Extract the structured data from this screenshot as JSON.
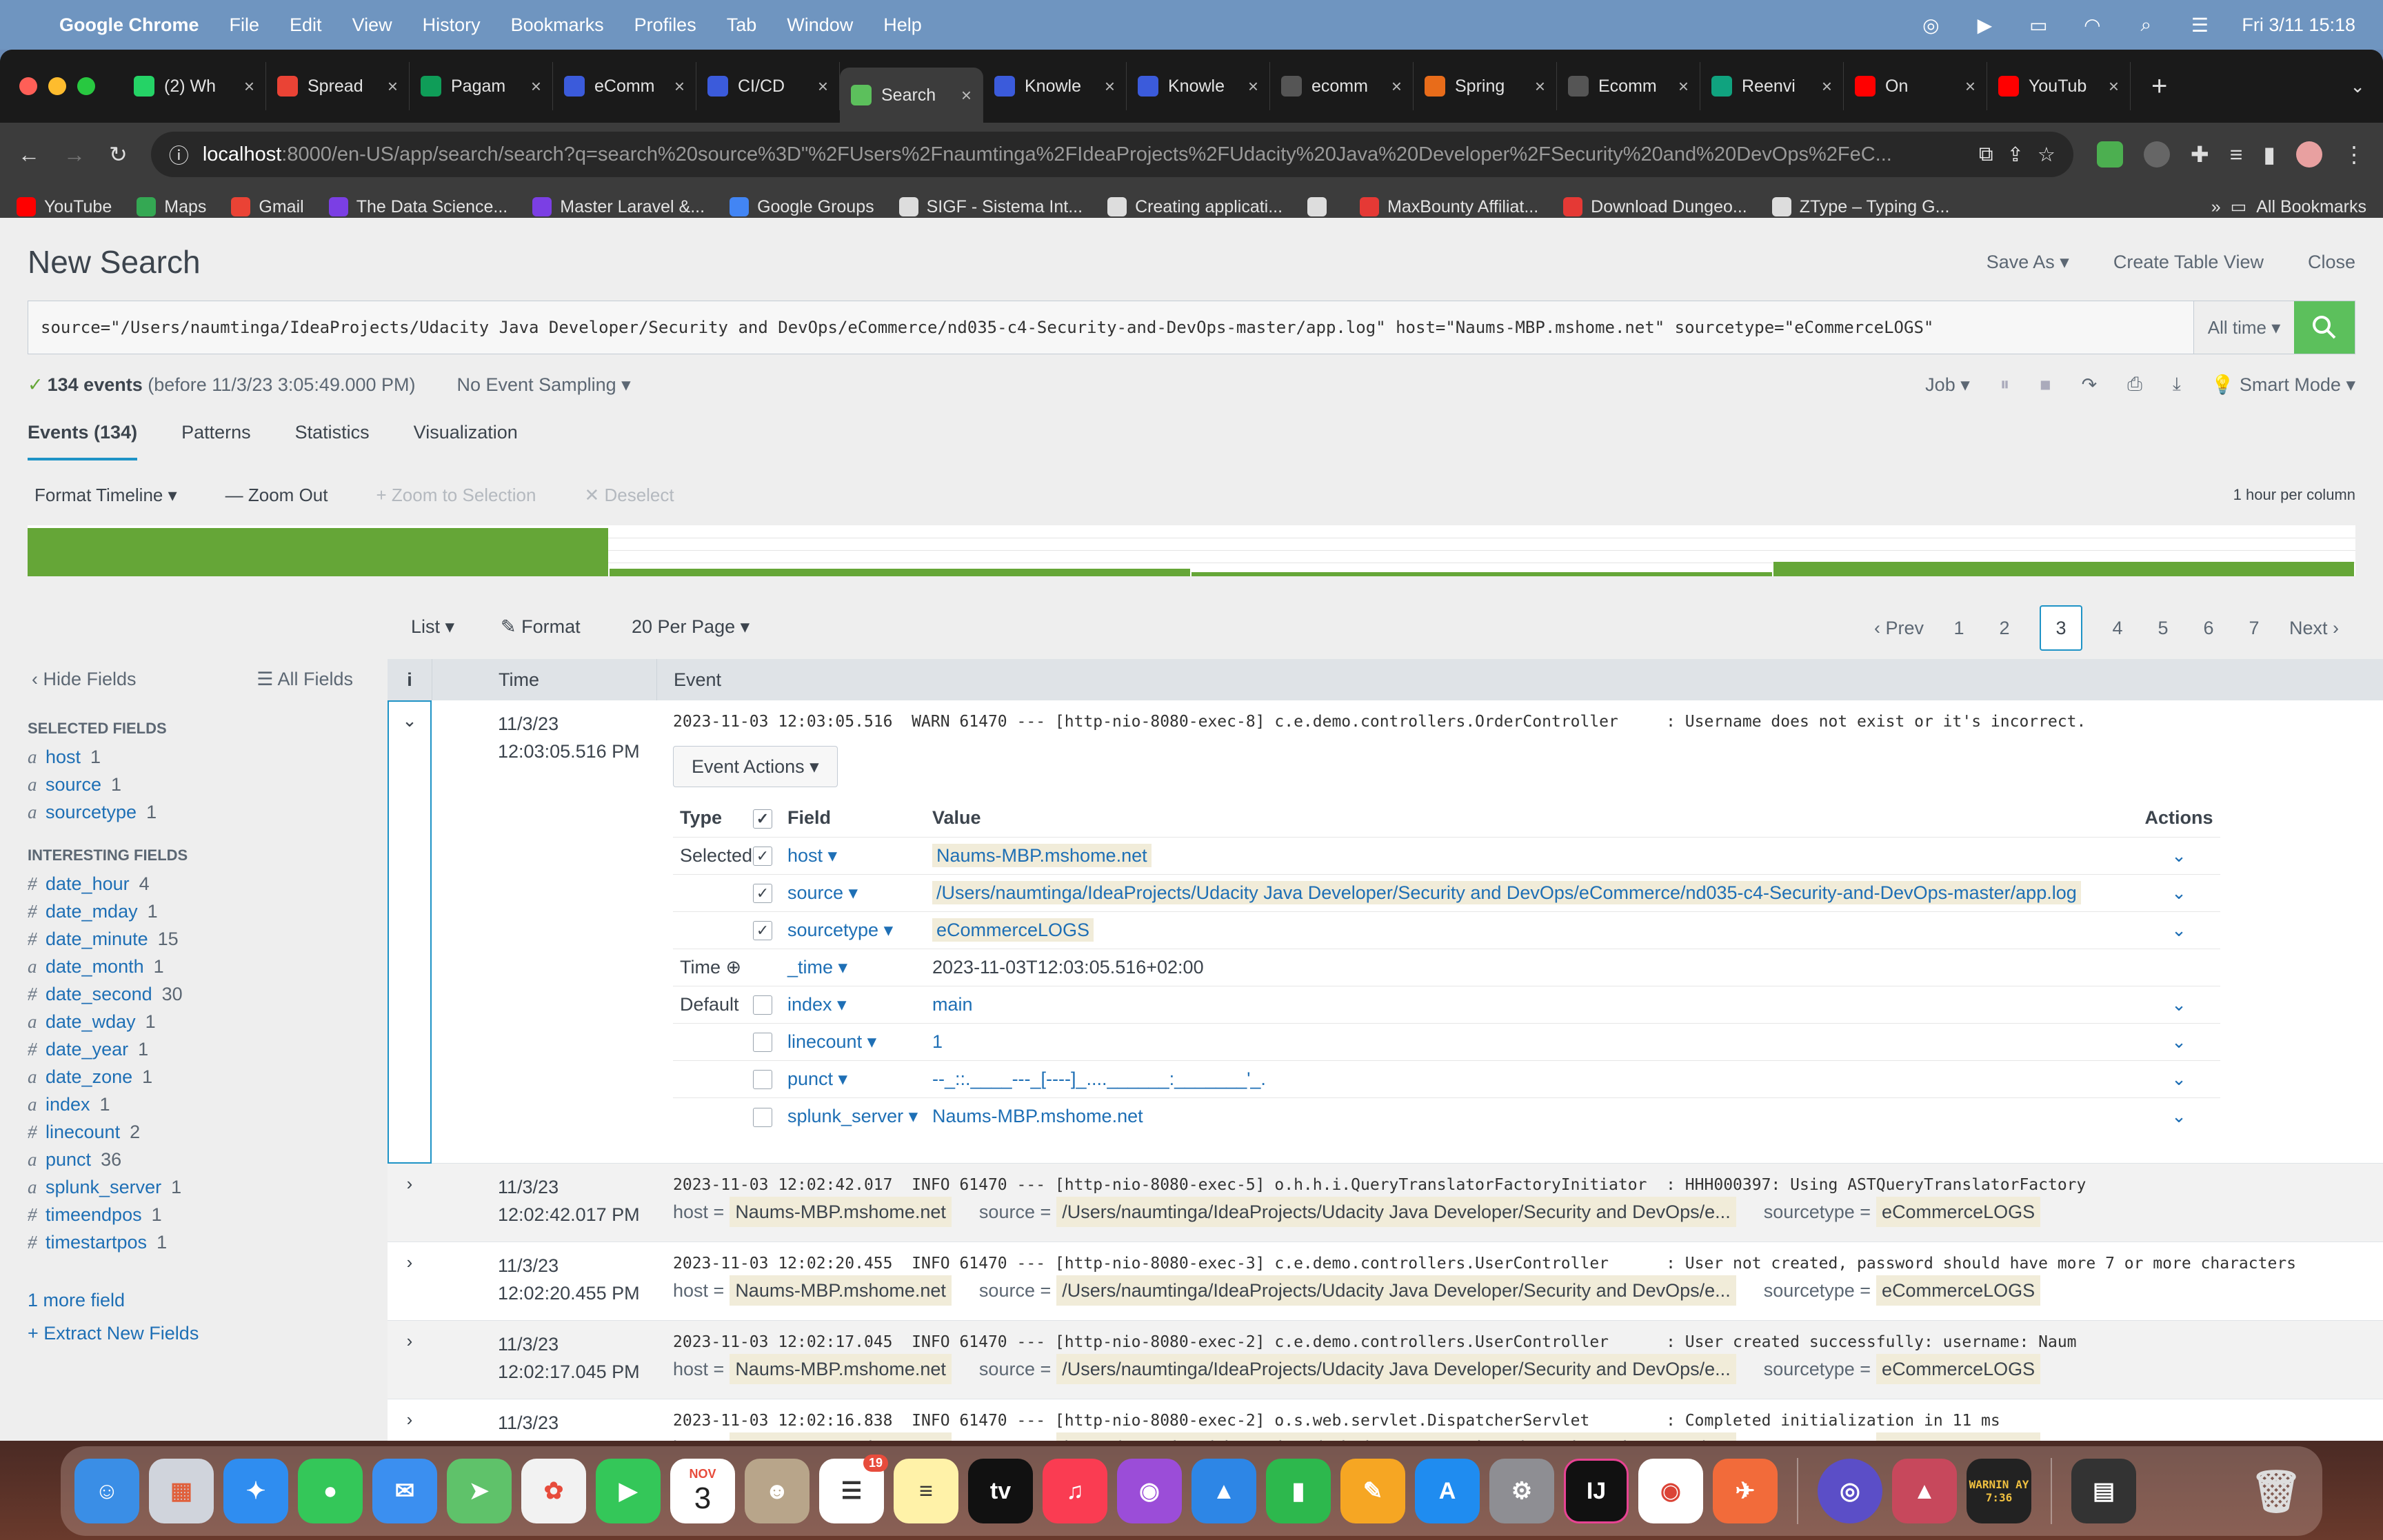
{
  "menubar": {
    "app": "Google Chrome",
    "menus": [
      "File",
      "Edit",
      "View",
      "History",
      "Bookmarks",
      "Profiles",
      "Tab",
      "Window",
      "Help"
    ],
    "datetime": "Fri 3/11  15:18"
  },
  "tabs": [
    {
      "title": "(2) Wh",
      "color": "#25d366"
    },
    {
      "title": "Spread",
      "color": "#ea4335"
    },
    {
      "title": "Pagam",
      "color": "#0f9d58"
    },
    {
      "title": "eComm",
      "color": "#3b5bdb"
    },
    {
      "title": "CI/CD",
      "color": "#3b5bdb"
    },
    {
      "title": "Search",
      "color": "#5cc05c",
      "active": true
    },
    {
      "title": "Knowle",
      "color": "#3b5bdb"
    },
    {
      "title": "Knowle",
      "color": "#3b5bdb"
    },
    {
      "title": "ecomm",
      "color": "#555555"
    },
    {
      "title": "Spring",
      "color": "#e86c1a"
    },
    {
      "title": "Ecomm",
      "color": "#555555"
    },
    {
      "title": "Reenvi",
      "color": "#10a37f"
    },
    {
      "title": "On",
      "color": "#ff0000"
    },
    {
      "title": "YouTub",
      "color": "#ff0000"
    }
  ],
  "omnibox": {
    "host": "localhost",
    "rest": ":8000/en-US/app/search/search?q=search%20source%3D\"%2FUsers%2Fnaumtinga%2FIdeaProjects%2FUdacity%20Java%20Developer%2FSecurity%20and%20DevOps%2FeC..."
  },
  "bookmarks": [
    {
      "label": "YouTube",
      "color": "#ff0000"
    },
    {
      "label": "Maps",
      "color": "#34a853"
    },
    {
      "label": "Gmail",
      "color": "#ea4335"
    },
    {
      "label": "The Data Science...",
      "color": "#7b3fe4"
    },
    {
      "label": "Master Laravel &...",
      "color": "#7b3fe4"
    },
    {
      "label": "Google Groups",
      "color": "#4285f4"
    },
    {
      "label": "SIGF - Sistema Int...",
      "color": "#dddddd"
    },
    {
      "label": "Creating applicati...",
      "color": "#dddddd"
    },
    {
      "label": "",
      "color": "#dddddd"
    },
    {
      "label": "MaxBounty Affiliat...",
      "color": "#e53935"
    },
    {
      "label": "Download Dungeo...",
      "color": "#e53935"
    },
    {
      "label": "ZType – Typing G...",
      "color": "#dddddd"
    }
  ],
  "bookmarks_more": "»",
  "all_bookmarks": "All Bookmarks",
  "splunk": {
    "title": "New Search",
    "save_as": "Save As ▾",
    "create_table_view": "Create Table View",
    "close": "Close",
    "query": "source=\"/Users/naumtinga/IdeaProjects/Udacity Java Developer/Security and DevOps/eCommerce/nd035-c4-Security-and-DevOps-master/app.log\" host=\"Naums-MBP.mshome.net\" sourcetype=\"eCommerceLOGS\"",
    "time_range": "All time ▾",
    "events_count": "134 events",
    "events_before": "(before 11/3/23 3:05:49.000 PM)",
    "sampling": "No Event Sampling ▾",
    "job": "Job ▾",
    "mode": "Smart Mode ▾",
    "tabs": [
      "Events (134)",
      "Patterns",
      "Statistics",
      "Visualization"
    ],
    "timeline_controls": {
      "format": "Format Timeline ▾",
      "zoom_out": "— Zoom Out",
      "zoom_sel": "+ Zoom to Selection",
      "deselect": "✕ Deselect",
      "per_column": "1 hour per column"
    },
    "timeline_bars": [
      1.0,
      0.15,
      0.05,
      0.3
    ],
    "list": "List ▾",
    "format": "Format",
    "per_page": "20 Per Page ▾",
    "pager": {
      "prev": "‹ Prev",
      "pages": [
        "1",
        "2",
        "3",
        "4",
        "5",
        "6",
        "7"
      ],
      "current": "3",
      "next": "Next ›"
    },
    "sidebar": {
      "hide": "‹ Hide Fields",
      "all": "☰ All Fields",
      "selected_header": "SELECTED FIELDS",
      "selected": [
        {
          "type": "a",
          "name": "host",
          "count": "1"
        },
        {
          "type": "a",
          "name": "source",
          "count": "1"
        },
        {
          "type": "a",
          "name": "sourcetype",
          "count": "1"
        }
      ],
      "interesting_header": "INTERESTING FIELDS",
      "interesting": [
        {
          "type": "#",
          "name": "date_hour",
          "count": "4"
        },
        {
          "type": "#",
          "name": "date_mday",
          "count": "1"
        },
        {
          "type": "#",
          "name": "date_minute",
          "count": "15"
        },
        {
          "type": "a",
          "name": "date_month",
          "count": "1"
        },
        {
          "type": "#",
          "name": "date_second",
          "count": "30"
        },
        {
          "type": "a",
          "name": "date_wday",
          "count": "1"
        },
        {
          "type": "#",
          "name": "date_year",
          "count": "1"
        },
        {
          "type": "a",
          "name": "date_zone",
          "count": "1"
        },
        {
          "type": "a",
          "name": "index",
          "count": "1"
        },
        {
          "type": "#",
          "name": "linecount",
          "count": "2"
        },
        {
          "type": "a",
          "name": "punct",
          "count": "36"
        },
        {
          "type": "a",
          "name": "splunk_server",
          "count": "1"
        },
        {
          "type": "#",
          "name": "timeendpos",
          "count": "1"
        },
        {
          "type": "#",
          "name": "timestartpos",
          "count": "1"
        }
      ],
      "more": "1 more field",
      "extract": "+ Extract New Fields"
    },
    "table_headers": {
      "info": "i",
      "time": "Time",
      "event": "Event"
    },
    "expanded_event": {
      "date": "11/3/23",
      "time": "12:03:05.516 PM",
      "raw": "2023-11-03 12:03:05.516  WARN 61470 --- [http-nio-8080-exec-8] c.e.demo.controllers.OrderController     : Username does not exist or it's incorrect.",
      "event_actions": "Event Actions ▾",
      "field_headers": {
        "type": "Type",
        "field": "Field",
        "value": "Value",
        "actions": "Actions"
      },
      "fields": [
        {
          "type": "Selected",
          "checked": true,
          "name": "host ▾",
          "value": "Naums-MBP.mshome.net",
          "hl": true
        },
        {
          "type": "",
          "checked": true,
          "name": "source ▾",
          "value": "/Users/naumtinga/IdeaProjects/Udacity Java Developer/Security and DevOps/eCommerce/nd035-c4-Security-and-DevOps-master/app.log",
          "hl": true
        },
        {
          "type": "",
          "checked": true,
          "name": "sourcetype ▾",
          "value": "eCommerceLOGS",
          "hl": true
        },
        {
          "type": "Time ⊕",
          "checked": null,
          "name": "_time ▾",
          "value": "2023-11-03T12:03:05.516+02:00",
          "hl": false
        },
        {
          "type": "Default",
          "checked": false,
          "name": "index ▾",
          "value": "main",
          "hl": false
        },
        {
          "type": "",
          "checked": false,
          "name": "linecount ▾",
          "value": "1",
          "hl": false
        },
        {
          "type": "",
          "checked": false,
          "name": "punct ▾",
          "value": "--_::.____---_[----]_....______:_______'_.",
          "hl": false
        },
        {
          "type": "",
          "checked": false,
          "name": "splunk_server ▾",
          "value": "Naums-MBP.mshome.net",
          "hl": false
        }
      ]
    },
    "events": [
      {
        "date": "11/3/23",
        "time": "12:02:42.017 PM",
        "raw": "2023-11-03 12:02:42.017  INFO 61470 --- [http-nio-8080-exec-5] o.h.h.i.QueryTranslatorFactoryInitiator  : HHH000397: Using ASTQueryTranslatorFactory"
      },
      {
        "date": "11/3/23",
        "time": "12:02:20.455 PM",
        "raw": "2023-11-03 12:02:20.455  INFO 61470 --- [http-nio-8080-exec-3] c.e.demo.controllers.UserController      : User not created, password should have more 7 or more characters"
      },
      {
        "date": "11/3/23",
        "time": "12:02:17.045 PM",
        "raw": "2023-11-03 12:02:17.045  INFO 61470 --- [http-nio-8080-exec-2] c.e.demo.controllers.UserController      : User created successfully: username: Naum"
      },
      {
        "date": "11/3/23",
        "time": "",
        "raw": "2023-11-03 12:02:16.838  INFO 61470 --- [http-nio-8080-exec-2] o.s.web.servlet.DispatcherServlet        : Completed initialization in 11 ms"
      }
    ],
    "event_kv": {
      "host_label": "host =",
      "host": "Naums-MBP.mshome.net",
      "source_label": "source =",
      "source": "/Users/naumtinga/IdeaProjects/Udacity Java Developer/Security and DevOps/e...",
      "sourcetype_label": "sourcetype =",
      "sourcetype": "eCommerceLOGS"
    }
  },
  "dock": {
    "calendar_month": "NOV",
    "calendar_day": "3",
    "reminders_badge": "19",
    "console_text": "WARNIN AY 7:36"
  }
}
